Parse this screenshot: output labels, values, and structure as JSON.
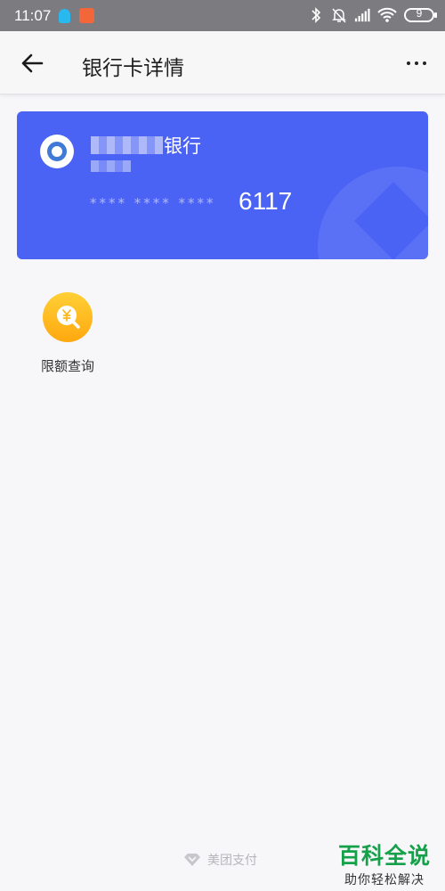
{
  "status_bar": {
    "time": "11:07",
    "battery": "9",
    "icons": [
      "qq-icon",
      "app-notification-icon",
      "bluetooth-icon",
      "mute-icon",
      "signal-icon",
      "wifi-icon",
      "battery-icon"
    ]
  },
  "header": {
    "back_icon": "back-arrow-icon",
    "title": "银行卡详情",
    "more_icon": "more-icon"
  },
  "card": {
    "bank_name_suffix": "银行",
    "masked_number": "**** **** ****",
    "last_four": "6117",
    "background_color": "#4b63f5"
  },
  "actions": [
    {
      "label": "限额查询",
      "icon": "yuan-search-icon",
      "color": "#ffb516"
    }
  ],
  "footer": {
    "brand": "美团支付"
  },
  "watermark": {
    "title": "百科全说",
    "subtitle": "助你轻松解决"
  }
}
